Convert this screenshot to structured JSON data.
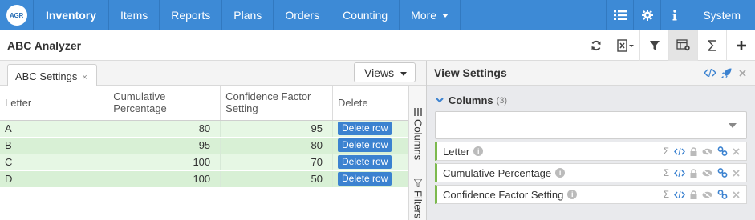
{
  "nav": {
    "logo_text": "AGR",
    "brand": "Inventory",
    "items": [
      "Items",
      "Reports",
      "Plans",
      "Orders",
      "Counting"
    ],
    "more": "More",
    "system": "System"
  },
  "page": {
    "title": "ABC Analyzer"
  },
  "left": {
    "tab_label": "ABC Settings",
    "tab_close": "×",
    "views_label": "Views",
    "columns": [
      "Letter",
      "Cumulative Percentage",
      "Confidence Factor Setting",
      "Delete"
    ],
    "rows": [
      {
        "letter": "A",
        "cumulative": "80",
        "confidence": "95",
        "action": "Delete row"
      },
      {
        "letter": "B",
        "cumulative": "95",
        "confidence": "80",
        "action": "Delete row"
      },
      {
        "letter": "C",
        "cumulative": "100",
        "confidence": "70",
        "action": "Delete row"
      },
      {
        "letter": "D",
        "cumulative": "100",
        "confidence": "50",
        "action": "Delete row"
      }
    ],
    "sidebar": {
      "columns": "Columns",
      "filters": "Filters"
    }
  },
  "right": {
    "title": "View Settings",
    "columns_heading": "Columns",
    "columns_count": "(3)",
    "column_items": [
      "Letter",
      "Cumulative Percentage",
      "Confidence Factor Setting"
    ]
  },
  "colors": {
    "nav_bg": "#3d8ad6",
    "row_light": "#e6f7e4",
    "row_dark": "#d8f0d5",
    "accent": "#3b82d0",
    "column_marker": "#7cb94e"
  }
}
